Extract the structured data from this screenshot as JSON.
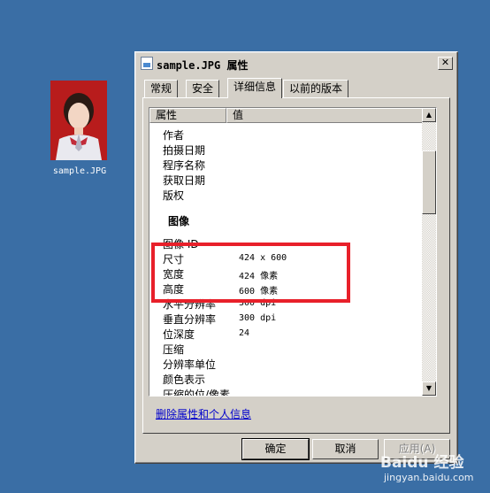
{
  "desktop": {
    "file_label": "sample.JPG"
  },
  "dialog": {
    "title": "sample.JPG 属性",
    "close_glyph": "✕",
    "tabs": [
      {
        "label": "常规",
        "active": false
      },
      {
        "label": "安全",
        "active": false
      },
      {
        "label": "详细信息",
        "active": true
      },
      {
        "label": "以前的版本",
        "active": false
      }
    ],
    "columns": {
      "property": "属性",
      "value": "值"
    },
    "rows_top": [
      {
        "name": "作者",
        "value": ""
      },
      {
        "name": "拍摄日期",
        "value": ""
      },
      {
        "name": "程序名称",
        "value": ""
      },
      {
        "name": "获取日期",
        "value": ""
      },
      {
        "name": "版权",
        "value": ""
      }
    ],
    "section_image": "图像",
    "rows_image": [
      {
        "name": "图像 ID",
        "value": ""
      },
      {
        "name": "尺寸",
        "value": "424 x 600"
      },
      {
        "name": "宽度",
        "value": "424 像素"
      },
      {
        "name": "高度",
        "value": "600 像素"
      },
      {
        "name": "水平分辨率",
        "value": "300 dpi"
      },
      {
        "name": "垂直分辨率",
        "value": "300 dpi"
      },
      {
        "name": "位深度",
        "value": "24"
      },
      {
        "name": "压缩",
        "value": ""
      },
      {
        "name": "分辨率单位",
        "value": ""
      },
      {
        "name": "颜色表示",
        "value": ""
      },
      {
        "name": "压缩的位/像素",
        "value": ""
      }
    ],
    "remove_link": "删除属性和个人信息",
    "buttons": {
      "ok": "确定",
      "cancel": "取消",
      "apply": "应用(A)"
    },
    "scroll_up": "▲",
    "scroll_down": "▼"
  },
  "watermark": {
    "brand": "Baidu 经验",
    "url": "jingyan.baidu.com"
  },
  "colors": {
    "desktop": "#3a6ea5",
    "dialog_face": "#d4d0c8",
    "highlight": "#e8202a",
    "link": "#0000cc"
  }
}
